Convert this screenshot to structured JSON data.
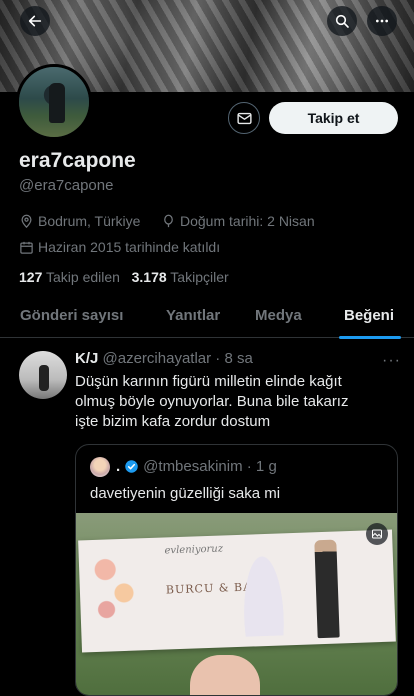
{
  "header": {
    "back_icon": "back-arrow-icon",
    "search_icon": "search-icon",
    "more_icon": "more-icon"
  },
  "profile": {
    "display_name": "era7capone",
    "handle": "@era7capone",
    "location": "Bodrum, Türkiye",
    "birthday": "Doğum tarihi: 2 Nisan",
    "joined": "Haziran 2015 tarihinde katıldı",
    "following_count": "127",
    "following_label": "Takip edilen",
    "followers_count": "3.178",
    "followers_label": "Takipçiler",
    "follow_button": "Takip et"
  },
  "tabs": [
    {
      "label": "Gönderi sayısı",
      "active": false
    },
    {
      "label": "Yanıtlar",
      "active": false
    },
    {
      "label": "Medya",
      "active": false
    },
    {
      "label": "Beğeni",
      "active": true
    }
  ],
  "post": {
    "author_name": "K/J",
    "author_handle": "@azercihayatlar",
    "time": "· 8 sa",
    "lines": [
      "Düşün karının figürü milletin elinde kağıt",
      "olmuş böyle oynuyorlar. Buna bile takarız",
      "işte bizim kafa zordur dostum"
    ],
    "more": "···"
  },
  "quote": {
    "author_name": ".",
    "author_handle": "@tmbesakinim",
    "time": "· 1 g",
    "text": "davetiyenin güzelliği saka mi",
    "card": {
      "script_text": "evleniyoruz",
      "names": "BURCU & BAR"
    }
  },
  "colors": {
    "background": "#000000",
    "text_primary": "#e7e9ea",
    "text_secondary": "#71767b",
    "accent": "#1d9bf0",
    "follow_button_bg": "#eff3f4",
    "border": "#2f3336"
  }
}
